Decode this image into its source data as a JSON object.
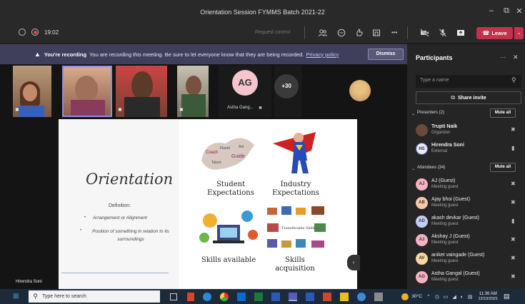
{
  "window": {
    "title": "Orientation Session FYMMS Batch 2021-22",
    "min": "–",
    "max": "⧉",
    "close": "✕"
  },
  "toolbar": {
    "timer": "19:02",
    "request_control": "Request control",
    "more": "•••",
    "leave": "Leave"
  },
  "banner": {
    "title": "You're recording",
    "message": "You are recording this meeting. Be sure to let everyone know that they are being recorded.",
    "link": "Privacy policy",
    "dismiss": "Dismiss"
  },
  "tiles": {
    "ag_initials": "AG",
    "ag_name": "Astha Gang...",
    "overflow": "+30"
  },
  "slide": {
    "title": "Orientation",
    "definition_label": "Definition:",
    "bullets": [
      "Arrangement or Alignment",
      "Position of something in relation to its surroundings"
    ],
    "cells": [
      "Student Expectations",
      "Industry Expectations",
      "Skills available",
      "Skills acquisition"
    ],
    "cloud_words": [
      "Coach",
      "Fluent",
      "Guide",
      "Talent",
      "Aid"
    ],
    "skill_label": "Transferable Skills"
  },
  "presenter_name": "Hirendra Soni",
  "participants": {
    "title": "Participants",
    "search_placeholder": "Type a name",
    "share_invite": "Share invite",
    "presenters_label": "Presenters (2)",
    "attendees_label": "Attendees (34)",
    "mute_all": "Mute all",
    "presenters": [
      {
        "name": "Trupti Naik",
        "role": "Organizer",
        "initials": ""
      },
      {
        "name": "Hirendra Soni",
        "role": "External",
        "initials": "HS"
      }
    ],
    "attendees": [
      {
        "name": "AJ (Guest)",
        "role": "Meeting guest",
        "initials": "AJ",
        "color": "#f3b3c0"
      },
      {
        "name": "Ajay bhoi (Guest)",
        "role": "Meeting guest",
        "initials": "AB",
        "color": "#f7c9a8"
      },
      {
        "name": "akash devkar (Guest)",
        "role": "Meeting guest",
        "initials": "AD",
        "color": "#c3cdf2"
      },
      {
        "name": "Akshay J (Guest)",
        "role": "Meeting guest",
        "initials": "AJ",
        "color": "#f3b3c0"
      },
      {
        "name": "aniket vaingade (Guest)",
        "role": "Meeting guest",
        "initials": "AV",
        "color": "#f7d7a0"
      },
      {
        "name": "Astha Gangal (Guest)",
        "role": "Meeting guest",
        "initials": "AG",
        "color": "#f3b3c0"
      }
    ]
  },
  "taskbar": {
    "search_placeholder": "Type here to search",
    "weather": "30°C",
    "time": "11:36 AM",
    "date": "12/10/2021"
  },
  "colors": {
    "leave": "#c4314b",
    "banner": "#3f3f5c",
    "accent": "#6264a7"
  }
}
